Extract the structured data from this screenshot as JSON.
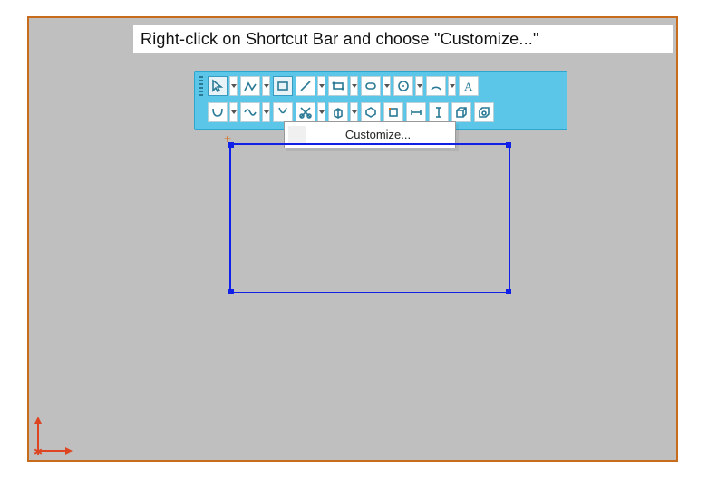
{
  "instruction": "Right-click on Shortcut Bar and choose \"Customize...\"",
  "context_menu": {
    "customize_label": "Customize..."
  },
  "toolbar": {
    "row1": [
      {
        "name": "pointer",
        "selected": true,
        "dd": true
      },
      {
        "name": "sketch",
        "dd": true
      },
      {
        "name": "rectangle",
        "selected": true,
        "dd": false
      },
      {
        "name": "line",
        "dd": true
      },
      {
        "name": "polygon-rect",
        "dd": true
      },
      {
        "name": "slot",
        "dd": true
      },
      {
        "name": "circle",
        "dd": true
      },
      {
        "name": "arc",
        "dd": true
      },
      {
        "name": "text",
        "dd": false
      }
    ],
    "row2": [
      {
        "name": "spline",
        "dd": true
      },
      {
        "name": "wave",
        "dd": true
      },
      {
        "name": "ellipse",
        "dd": false
      },
      {
        "name": "trim",
        "dd": true
      },
      {
        "name": "cube",
        "dd": true
      },
      {
        "name": "hexagon",
        "dd": false
      },
      {
        "name": "square",
        "dd": false
      },
      {
        "name": "dim-h",
        "dd": false
      },
      {
        "name": "dim-v",
        "dd": false
      },
      {
        "name": "box1",
        "dd": false
      },
      {
        "name": "box2",
        "dd": false
      }
    ]
  }
}
